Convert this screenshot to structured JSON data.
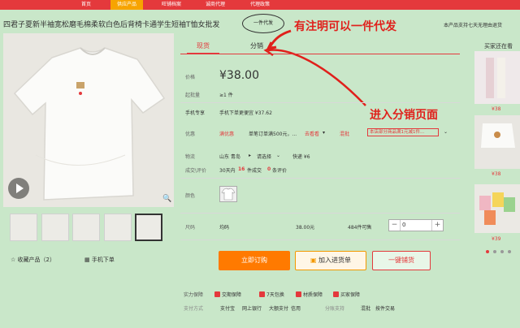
{
  "nav": {
    "items": [
      {
        "label": "首页",
        "active": false
      },
      {
        "label": "供应产品",
        "active": true
      },
      {
        "label": "旺铺档案",
        "active": false
      },
      {
        "label": "诚商代理",
        "active": false
      },
      {
        "label": "代理政策",
        "active": false
      }
    ]
  },
  "product": {
    "title": "四君子夏新半袖宽松磨毛棉柔软白色后背椅卡通学生短袖T恤女批发",
    "yijian_label": "一件代发",
    "annotation_top": "有注明可以一件代发",
    "annotation_mid": "进入分销页面",
    "support_text": "本产品支持七天无理由退货",
    "favorite": "收藏产品（2）",
    "mobile_order": "手机下单"
  },
  "tabs": [
    {
      "label": "现货",
      "active": true
    },
    {
      "label": "分销",
      "active": false
    }
  ],
  "price": {
    "label": "价格",
    "value": "¥38.00",
    "moq_label": "起批量",
    "moq_value": "≥1 件"
  },
  "mobile_exclusive": {
    "label": "手机专享",
    "text": "手机下单更便宜 ¥37.62"
  },
  "promo": {
    "label": "优惠",
    "tag": "满优惠",
    "desc": "单笔订单满500元，...",
    "link": "去看看",
    "mix": "混批",
    "coupon": "本店部分商品满1元减1件..."
  },
  "logistics": {
    "label": "物流",
    "from": "山东 青岛",
    "to_label": "请选择",
    "express": "快递 ¥6"
  },
  "deals": {
    "label": "成交\\评价",
    "days": "30天内",
    "count": "16",
    "unit": "件成交",
    "reviews": "0",
    "reviews_unit": "条评价"
  },
  "color": {
    "label": "颜色"
  },
  "size": {
    "label": "尺码",
    "name": "均码",
    "price": "38.00元",
    "stock": "484件可售",
    "qty": "0"
  },
  "buttons": {
    "buy": "立即订购",
    "cart": "加入进货单",
    "dist": "一键铺货"
  },
  "guarantee": {
    "label": "实力保障",
    "items": [
      "交期保障",
      "7天包换",
      "材质保障",
      "买家保障"
    ],
    "pay_label": "支付方式",
    "pay_items": [
      "支付宝",
      "网上银行",
      "大额支付",
      "信用"
    ],
    "pay_extra": "分账支持",
    "mix_label": "混批",
    "batch_label": "按件交易"
  },
  "recommend": {
    "title": "买家还在看",
    "items": [
      {
        "price": "¥38"
      },
      {
        "price": "¥38"
      },
      {
        "price": "¥39"
      }
    ]
  },
  "colors": {
    "accent": "#e4393c",
    "orange": "#ff7a00",
    "bg": "#c9e7c9"
  }
}
